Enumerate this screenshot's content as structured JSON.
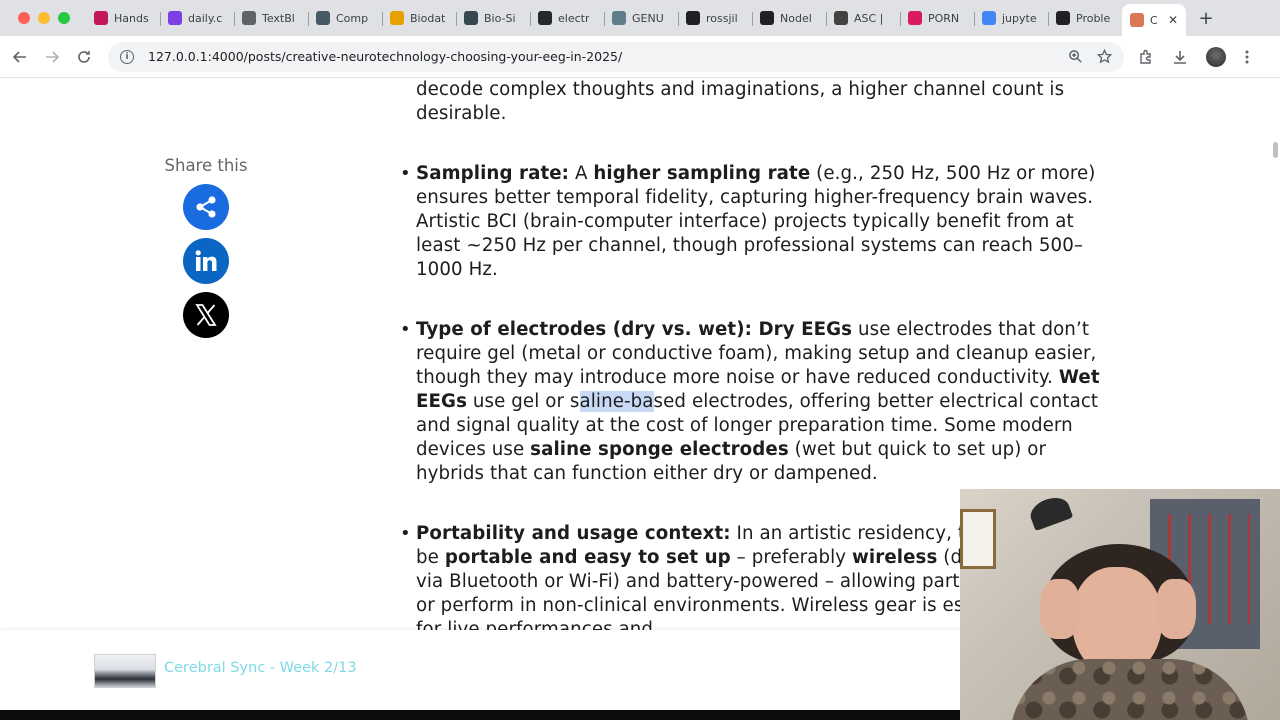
{
  "browser": {
    "tabs": [
      {
        "label": "Hands",
        "icon": "heart-icon",
        "color": "#c2185b"
      },
      {
        "label": "daily.c",
        "icon": "daily-icon",
        "color": "#7b3fe4"
      },
      {
        "label": "TextBl",
        "icon": "document-icon",
        "color": "#5f6368"
      },
      {
        "label": "Comp",
        "icon": "book-icon",
        "color": "#455a64"
      },
      {
        "label": "Biodat",
        "icon": "crown-icon",
        "color": "#e6a100"
      },
      {
        "label": "Bio-Si",
        "icon": "gear-icon",
        "color": "#37474f"
      },
      {
        "label": "electr",
        "icon": "github-icon",
        "color": "#24292f"
      },
      {
        "label": "GENU",
        "icon": "grid-icon",
        "color": "#607d8b"
      },
      {
        "label": "rossjil",
        "icon": "chart-icon",
        "color": "#202124"
      },
      {
        "label": "Nodel",
        "icon": "node-icon",
        "color": "#212121"
      },
      {
        "label": "ASC |",
        "icon": "asc-icon",
        "color": "#424242"
      },
      {
        "label": "PORN",
        "icon": "circle-icon",
        "color": "#d81b60"
      },
      {
        "label": "jupyte",
        "icon": "google-icon",
        "color": "#4285f4"
      },
      {
        "label": "Proble",
        "icon": "openai-icon",
        "color": "#202124"
      },
      {
        "label": "C",
        "icon": "claude-icon",
        "color": "#d97757",
        "active": true
      }
    ],
    "url": "127.0.0.1:4000/posts/creative-neurotechnology-choosing-your-eeg-in-2025/"
  },
  "share": {
    "title": "Share this"
  },
  "article": {
    "intro": "decode complex thoughts and imaginations, a higher channel count is desirable.",
    "items": [
      {
        "lead": "Sampling rate:",
        "p1": " A ",
        "b1": "higher sampling rate",
        "p2": " (e.g., 250 Hz, 500 Hz or more) ensures better temporal fidelity, capturing higher-frequency brain waves. Artistic BCI (brain-computer interface) projects typically benefit from at least ~250 Hz per channel, though professional systems can reach 500–1000 Hz."
      },
      {
        "lead": "Type of electrodes (dry vs. wet): Dry EEGs",
        "p1": " use electrodes that don’t require gel (metal or conductive foam), making setup and cleanup easier, though they may introduce more noise or have reduced conductivity. ",
        "b1": "Wet EEGs",
        "p2a": " use gel or s",
        "hl": "aline-ba",
        "p2b": "sed electrodes, offering better electrical contact and signal quality at the cost of longer preparation time. Some modern devices use ",
        "b2": "saline sponge electrodes",
        "p3": " (wet but quick to set up) or hybrids that can function either dry or dampened."
      },
      {
        "lead": "Portability and usage context:",
        "p1": " In an artistic residency, the EEG should be ",
        "b1": "portable and easy to set up",
        "p2": " – preferably ",
        "b2": "wireless",
        "p3": " (data transmitted via Bluetooth or Wi-Fi) and battery-powered – allowing participants to move or perform in non-clinical environments. Wireless gear is especially useful for live performances and"
      }
    ]
  },
  "bottom_bar": {
    "title": "Cerebral Sync - Week 2/13"
  }
}
